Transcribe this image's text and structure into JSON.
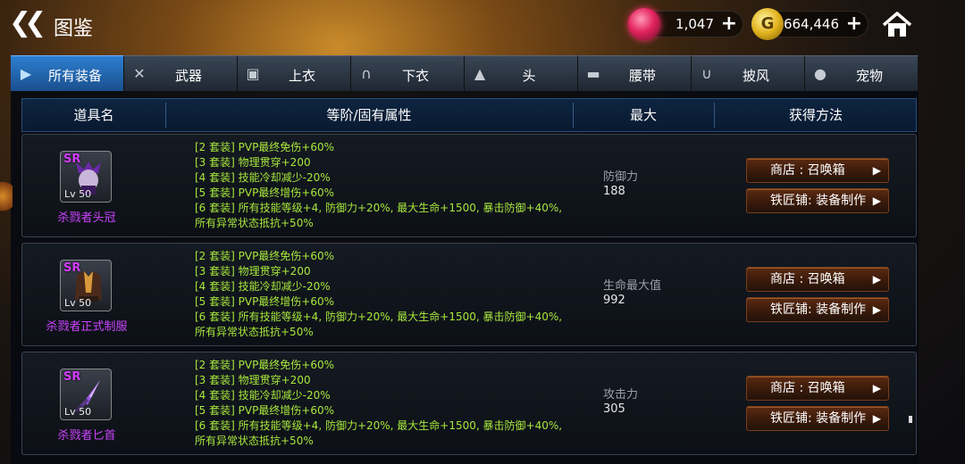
{
  "header": {
    "title": "图鉴",
    "gems": "1,047",
    "gold": "664,446",
    "gold_symbol": "G"
  },
  "tabs": [
    {
      "label": "所有装备",
      "icon": "play-icon",
      "active": true
    },
    {
      "label": "武器",
      "icon": "crossed-swords-icon",
      "active": false
    },
    {
      "label": "上衣",
      "icon": "shirt-icon",
      "active": false
    },
    {
      "label": "下衣",
      "icon": "pants-icon",
      "active": false
    },
    {
      "label": "头",
      "icon": "helmet-icon",
      "active": false
    },
    {
      "label": "腰带",
      "icon": "belt-icon",
      "active": false
    },
    {
      "label": "披风",
      "icon": "cape-icon",
      "active": false
    },
    {
      "label": "宠物",
      "icon": "pet-icon",
      "active": false
    }
  ],
  "table_header": {
    "name": "道具名",
    "attr": "等阶/固有属性",
    "max": "最大",
    "source": "获得方法"
  },
  "items": [
    {
      "rarity": "SR",
      "level": "Lv 50",
      "name": "杀戮者头冠",
      "icon": "helmet-item-icon",
      "set_bonuses": [
        "[2 套装] PVP最终免伤+60%",
        "[3 套装] 物理贯穿+200",
        "[4 套装] 技能冷却减少-20%",
        "[5 套装] PVP最终增伤+60%",
        "[6 套装] 所有技能等级+4, 防御力+20%, 最大生命+1500, 暴击防御+40%, 所有异常状态抵抗+50%"
      ],
      "stat_name": "防御力",
      "stat_value": "188",
      "shop_label": "商店 : 召唤箱",
      "smith_label": "铁匠铺: 装备制作"
    },
    {
      "rarity": "SR",
      "level": "Lv 50",
      "name": "杀戮者正式制服",
      "icon": "armor-item-icon",
      "set_bonuses": [
        "[2 套装] PVP最终免伤+60%",
        "[3 套装] 物理贯穿+200",
        "[4 套装] 技能冷却减少-20%",
        "[5 套装] PVP最终增伤+60%",
        "[6 套装] 所有技能等级+4, 防御力+20%, 最大生命+1500, 暴击防御+40%, 所有异常状态抵抗+50%"
      ],
      "stat_name": "生命最大值",
      "stat_value": "992",
      "shop_label": "商店 : 召唤箱",
      "smith_label": "铁匠铺: 装备制作"
    },
    {
      "rarity": "SR",
      "level": "Lv 50",
      "name": "杀戮者匕首",
      "icon": "dagger-item-icon",
      "set_bonuses": [
        "[2 套装] PVP最终免伤+60%",
        "[3 套装] 物理贯穿+200",
        "[4 套装] 技能冷却减少-20%",
        "[5 套装] PVP最终增伤+60%",
        "[6 套装] 所有技能等级+4, 防御力+20%, 最大生命+1500, 暴击防御+40%, 所有异常状态抵抗+50%"
      ],
      "stat_name": "攻击力",
      "stat_value": "305",
      "shop_label": "商店 : 召唤箱",
      "smith_label": "铁匠铺: 装备制作"
    }
  ],
  "colors": {
    "set_text": "#a8e83c",
    "item_name": "#cc44ff",
    "tab_active": "#2d7fd0"
  }
}
